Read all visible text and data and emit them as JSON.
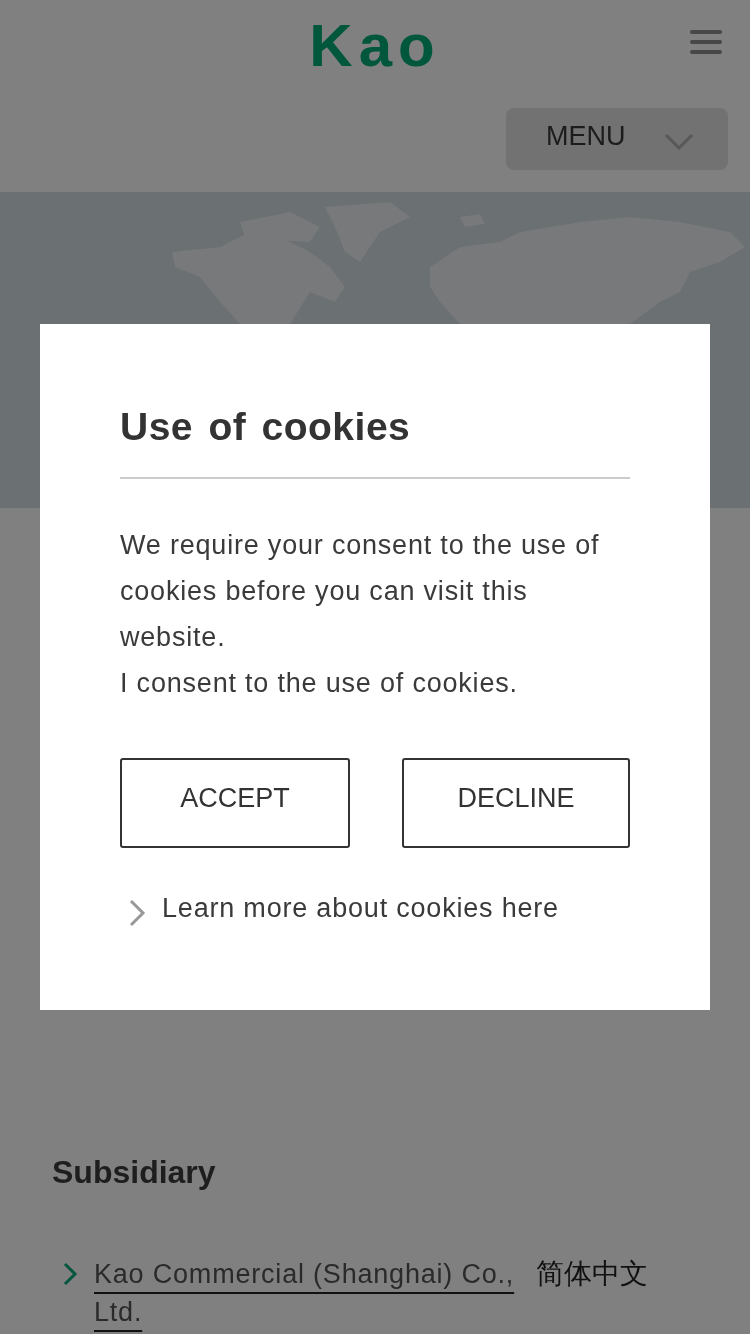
{
  "header": {
    "logo": "Kao",
    "menu_button": "MENU"
  },
  "dialog": {
    "title": "Use of cookies",
    "paragraphs": [
      "We require your consent to the use of cookies before you can visit this website.",
      "I consent to the use of cookies."
    ],
    "buttons": [
      "ACCEPT",
      "DECLINE"
    ],
    "link": "Learn more about cookies here"
  },
  "section": {
    "heading": "Subsidiary",
    "links": [
      {
        "name": "Kao Commercial (Shanghai) Co., Ltd.",
        "language": "简体中文"
      }
    ]
  }
}
